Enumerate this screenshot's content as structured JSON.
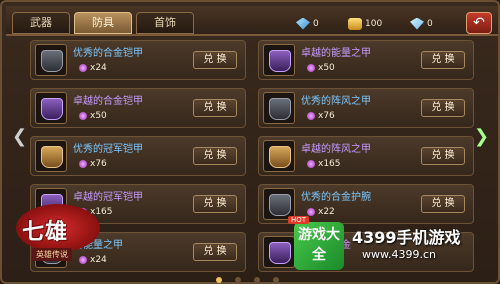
{
  "tabs": [
    {
      "label": "武器",
      "active": false
    },
    {
      "label": "防具",
      "active": true
    },
    {
      "label": "首饰",
      "active": false
    }
  ],
  "currency": [
    {
      "icon": "gem-icon",
      "value": "0"
    },
    {
      "icon": "gold-icon",
      "value": "100"
    },
    {
      "icon": "diamond-icon",
      "value": "0"
    }
  ],
  "back_icon": "back-arrow-icon",
  "left_items": [
    {
      "name": "优秀的合金铠甲",
      "cost": "x24",
      "button": "兑 换",
      "rarity": "blue"
    },
    {
      "name": "卓越的合金铠甲",
      "cost": "x50",
      "button": "兑 换",
      "rarity": "purple"
    },
    {
      "name": "优秀的冠军铠甲",
      "cost": "x76",
      "button": "兑 换",
      "rarity": "blue"
    },
    {
      "name": "卓越的冠军铠甲",
      "cost": "x165",
      "button": "兑 换",
      "rarity": "purple"
    },
    {
      "name": "的能量之甲",
      "cost": "x24",
      "button": "兑 换",
      "rarity": "blue"
    }
  ],
  "right_items": [
    {
      "name": "卓越的能量之甲",
      "cost": "x50",
      "button": "兑 换",
      "rarity": "purple"
    },
    {
      "name": "优秀的阵风之甲",
      "cost": "x76",
      "button": "兑 换",
      "rarity": "blue"
    },
    {
      "name": "卓越的阵风之甲",
      "cost": "x165",
      "button": "兑 换",
      "rarity": "purple"
    },
    {
      "name": "优秀的合金护腕",
      "cost": "x22",
      "button": "兑 换",
      "rarity": "blue"
    },
    {
      "name": "卓越的合金",
      "cost": "",
      "button": "",
      "rarity": "purple"
    }
  ],
  "logo": {
    "title": "七雄",
    "subtitle": "英雄传说"
  },
  "watermark": {
    "badge": "游戏大全",
    "hot": "HOT",
    "brand": "4399手机游戏",
    "url": "www.4399.cn"
  }
}
